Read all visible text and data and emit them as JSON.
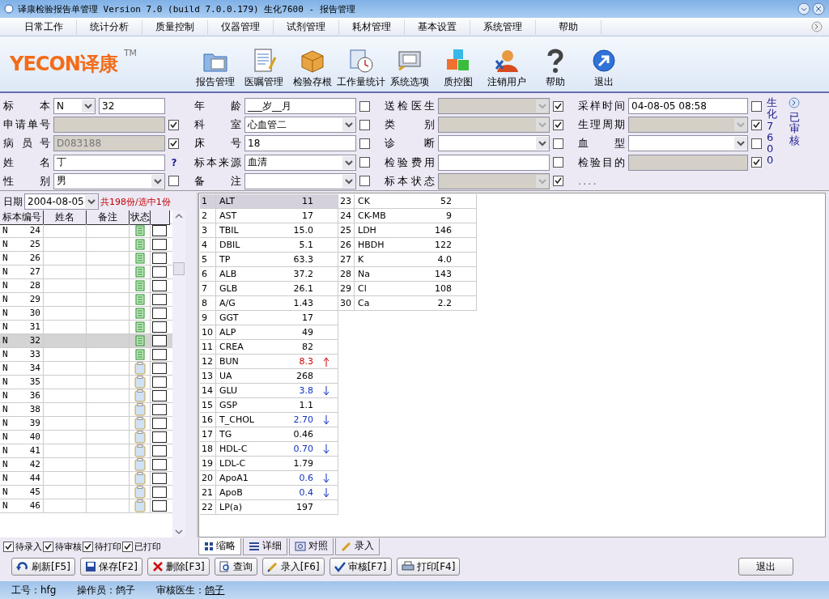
{
  "window": {
    "title": "译康检验报告单管理 Version 7.0 (build 7.0.0.179) 生化7600 - 报告管理"
  },
  "menu": [
    "日常工作",
    "统计分析",
    "质量控制",
    "仪器管理",
    "试剂管理",
    "耗材管理",
    "基本设置",
    "系统管理",
    "帮助"
  ],
  "logo": {
    "text": "YECON译康",
    "mark": "TM"
  },
  "toolbar": [
    "报告管理",
    "医嘱管理",
    "检验存根",
    "工作量统计",
    "系统选项",
    "质控图",
    "注销用户",
    "帮助",
    "退出"
  ],
  "form": {
    "rows": [
      [
        {
          "label": "标本",
          "kind": "split",
          "prefix": "N",
          "value": "32"
        },
        {
          "label": "年龄",
          "kind": "text",
          "value": "___岁__月",
          "checked": false
        },
        {
          "label": "送检医生",
          "kind": "disabled_select",
          "checked": true
        },
        {
          "label": "采样时间",
          "kind": "text",
          "value": "04-08-05 08:58",
          "checked": false
        }
      ],
      [
        {
          "label": "申请单号",
          "kind": "disabled",
          "checked": true
        },
        {
          "label": "科室",
          "kind": "select",
          "value": "心血管二",
          "checked": false
        },
        {
          "label": "类别",
          "kind": "disabled_select",
          "checked": true
        },
        {
          "label": "生理周期",
          "kind": "disabled_select",
          "checked": true
        }
      ],
      [
        {
          "label": "病员号",
          "kind": "disabled",
          "value": "D083188",
          "checked": true
        },
        {
          "label": "床号",
          "kind": "text",
          "value": "18",
          "checked": false
        },
        {
          "label": "诊断",
          "kind": "select",
          "checked": false
        },
        {
          "label": "血型",
          "kind": "select",
          "checked": false
        }
      ],
      [
        {
          "label": "姓名",
          "kind": "text",
          "value": "丁",
          "hint": "?"
        },
        {
          "label": "标本来源",
          "kind": "select",
          "value": "血清",
          "checked": false
        },
        {
          "label": "检验费用",
          "kind": "text",
          "checked": false
        },
        {
          "label": "检验目的",
          "kind": "disabled",
          "checked": true
        }
      ],
      [
        {
          "label": "性别",
          "kind": "select",
          "value": "男",
          "checked": false
        },
        {
          "label": "备注",
          "kind": "select",
          "checked": false
        },
        {
          "label": "标本状态",
          "kind": "disabled_select",
          "checked": true
        },
        {
          "label": "....",
          "kind": "note"
        }
      ]
    ],
    "instrument": "生化7600",
    "status": "已审核"
  },
  "list": {
    "date_label": "日期",
    "date": "2004-08-05",
    "summary": "共198份/选中1份",
    "columns": [
      "标本编号",
      "姓名",
      "备注",
      "状态"
    ],
    "rows": [
      {
        "prefix": "N",
        "number": "24",
        "kind": "done",
        "selected": false,
        "checked": false
      },
      {
        "prefix": "N",
        "number": "25",
        "kind": "done",
        "selected": false,
        "checked": false
      },
      {
        "prefix": "N",
        "number": "26",
        "kind": "done",
        "selected": false,
        "checked": false
      },
      {
        "prefix": "N",
        "number": "27",
        "kind": "done",
        "selected": false,
        "checked": false
      },
      {
        "prefix": "N",
        "number": "28",
        "kind": "done",
        "selected": false,
        "checked": false
      },
      {
        "prefix": "N",
        "number": "29",
        "kind": "done",
        "selected": false,
        "checked": false
      },
      {
        "prefix": "N",
        "number": "30",
        "kind": "done",
        "selected": false,
        "checked": false
      },
      {
        "prefix": "N",
        "number": "31",
        "kind": "done",
        "selected": false,
        "checked": false
      },
      {
        "prefix": "N",
        "number": "32",
        "kind": "done",
        "selected": true,
        "checked": false
      },
      {
        "prefix": "N",
        "number": "33",
        "kind": "done",
        "selected": false,
        "checked": false
      },
      {
        "prefix": "N",
        "number": "34",
        "kind": "pending",
        "selected": false,
        "checked": false
      },
      {
        "prefix": "N",
        "number": "35",
        "kind": "pending",
        "selected": false,
        "checked": false
      },
      {
        "prefix": "N",
        "number": "36",
        "kind": "pending",
        "selected": false,
        "checked": false
      },
      {
        "prefix": "N",
        "number": "38",
        "kind": "pending",
        "selected": false,
        "checked": false
      },
      {
        "prefix": "N",
        "number": "39",
        "kind": "pending",
        "selected": false,
        "checked": false
      },
      {
        "prefix": "N",
        "number": "40",
        "kind": "pending",
        "selected": false,
        "checked": false
      },
      {
        "prefix": "N",
        "number": "41",
        "kind": "pending",
        "selected": false,
        "checked": false
      },
      {
        "prefix": "N",
        "number": "42",
        "kind": "pending",
        "selected": false,
        "checked": false
      },
      {
        "prefix": "N",
        "number": "44",
        "kind": "pending",
        "selected": false,
        "checked": false
      },
      {
        "prefix": "N",
        "number": "45",
        "kind": "pending",
        "selected": false,
        "checked": false
      },
      {
        "prefix": "N",
        "number": "46",
        "kind": "pending",
        "selected": false,
        "checked": false
      }
    ],
    "filters": [
      {
        "label": "待录入",
        "checked": true
      },
      {
        "label": "待审核",
        "checked": true
      },
      {
        "label": "待打印",
        "checked": true
      },
      {
        "label": "已打印",
        "checked": true
      }
    ]
  },
  "results": {
    "columns": [
      [
        {
          "index": "1",
          "name": "ALT",
          "value": "11",
          "kind": "normal",
          "selected": true
        },
        {
          "index": "2",
          "name": "AST",
          "value": "17",
          "kind": "normal",
          "selected": false
        },
        {
          "index": "3",
          "name": "TBIL",
          "value": "15.0",
          "kind": "normal",
          "selected": false
        },
        {
          "index": "4",
          "name": "DBIL",
          "value": "5.1",
          "kind": "normal",
          "selected": false
        },
        {
          "index": "5",
          "name": "TP",
          "value": "63.3",
          "kind": "normal",
          "selected": false
        },
        {
          "index": "6",
          "name": "ALB",
          "value": "37.2",
          "kind": "normal",
          "selected": false
        },
        {
          "index": "7",
          "name": "GLB",
          "value": "26.1",
          "kind": "normal",
          "selected": false
        },
        {
          "index": "8",
          "name": "A/G",
          "value": "1.43",
          "kind": "normal",
          "selected": false
        },
        {
          "index": "9",
          "name": "GGT",
          "value": "17",
          "kind": "normal",
          "selected": false
        },
        {
          "index": "10",
          "name": "ALP",
          "value": "49",
          "kind": "normal",
          "selected": false
        },
        {
          "index": "11",
          "name": "CREA",
          "value": "82",
          "kind": "normal",
          "selected": false
        },
        {
          "index": "12",
          "name": "BUN",
          "value": "8.3",
          "kind": "high",
          "selected": false
        },
        {
          "index": "13",
          "name": "UA",
          "value": "268",
          "kind": "normal",
          "selected": false
        },
        {
          "index": "14",
          "name": "GLU",
          "value": "3.8",
          "kind": "low",
          "selected": false
        },
        {
          "index": "15",
          "name": "GSP",
          "value": "1.1",
          "kind": "normal",
          "selected": false
        },
        {
          "index": "16",
          "name": "T_CHOL",
          "value": "2.70",
          "kind": "low",
          "selected": false
        },
        {
          "index": "17",
          "name": "TG",
          "value": "0.46",
          "kind": "normal",
          "selected": false
        },
        {
          "index": "18",
          "name": "HDL-C",
          "value": "0.70",
          "kind": "low",
          "selected": false
        },
        {
          "index": "19",
          "name": "LDL-C",
          "value": "1.79",
          "kind": "normal",
          "selected": false
        },
        {
          "index": "20",
          "name": "ApoA1",
          "value": "0.6",
          "kind": "low",
          "selected": false
        },
        {
          "index": "21",
          "name": "ApoB",
          "value": "0.4",
          "kind": "low",
          "selected": false
        },
        {
          "index": "22",
          "name": "LP(a)",
          "value": "197",
          "kind": "normal",
          "selected": false
        }
      ],
      [
        {
          "index": "23",
          "name": "CK",
          "value": "52",
          "kind": "normal",
          "selected": false
        },
        {
          "index": "24",
          "name": "CK-MB",
          "value": "9",
          "kind": "normal",
          "selected": false
        },
        {
          "index": "25",
          "name": "LDH",
          "value": "146",
          "kind": "normal",
          "selected": false
        },
        {
          "index": "26",
          "name": "HBDH",
          "value": "122",
          "kind": "normal",
          "selected": false
        },
        {
          "index": "27",
          "name": "K",
          "value": "4.0",
          "kind": "normal",
          "selected": false
        },
        {
          "index": "28",
          "name": "Na",
          "value": "143",
          "kind": "normal",
          "selected": false
        },
        {
          "index": "29",
          "name": "Cl",
          "value": "108",
          "kind": "normal",
          "selected": false
        },
        {
          "index": "30",
          "name": "Ca",
          "value": "2.2",
          "kind": "normal",
          "selected": false
        }
      ]
    ]
  },
  "tabs": [
    {
      "label": "缩略",
      "selected": true
    },
    {
      "label": "详细",
      "selected": false
    },
    {
      "label": "对照",
      "selected": false
    },
    {
      "label": "录入",
      "selected": false
    }
  ],
  "buttons": [
    "刷新[F5]",
    "保存[F2]",
    "删除[F3]",
    "查询",
    "录入[F6]",
    "审核[F7]",
    "打印[F4]"
  ],
  "exit_button": "退出",
  "status_bar": [
    {
      "label": "工号：",
      "value": "hfg"
    },
    {
      "label": "操作员：",
      "value": "鸽子"
    },
    {
      "label": "审核医生：",
      "value": "鸽子"
    }
  ]
}
